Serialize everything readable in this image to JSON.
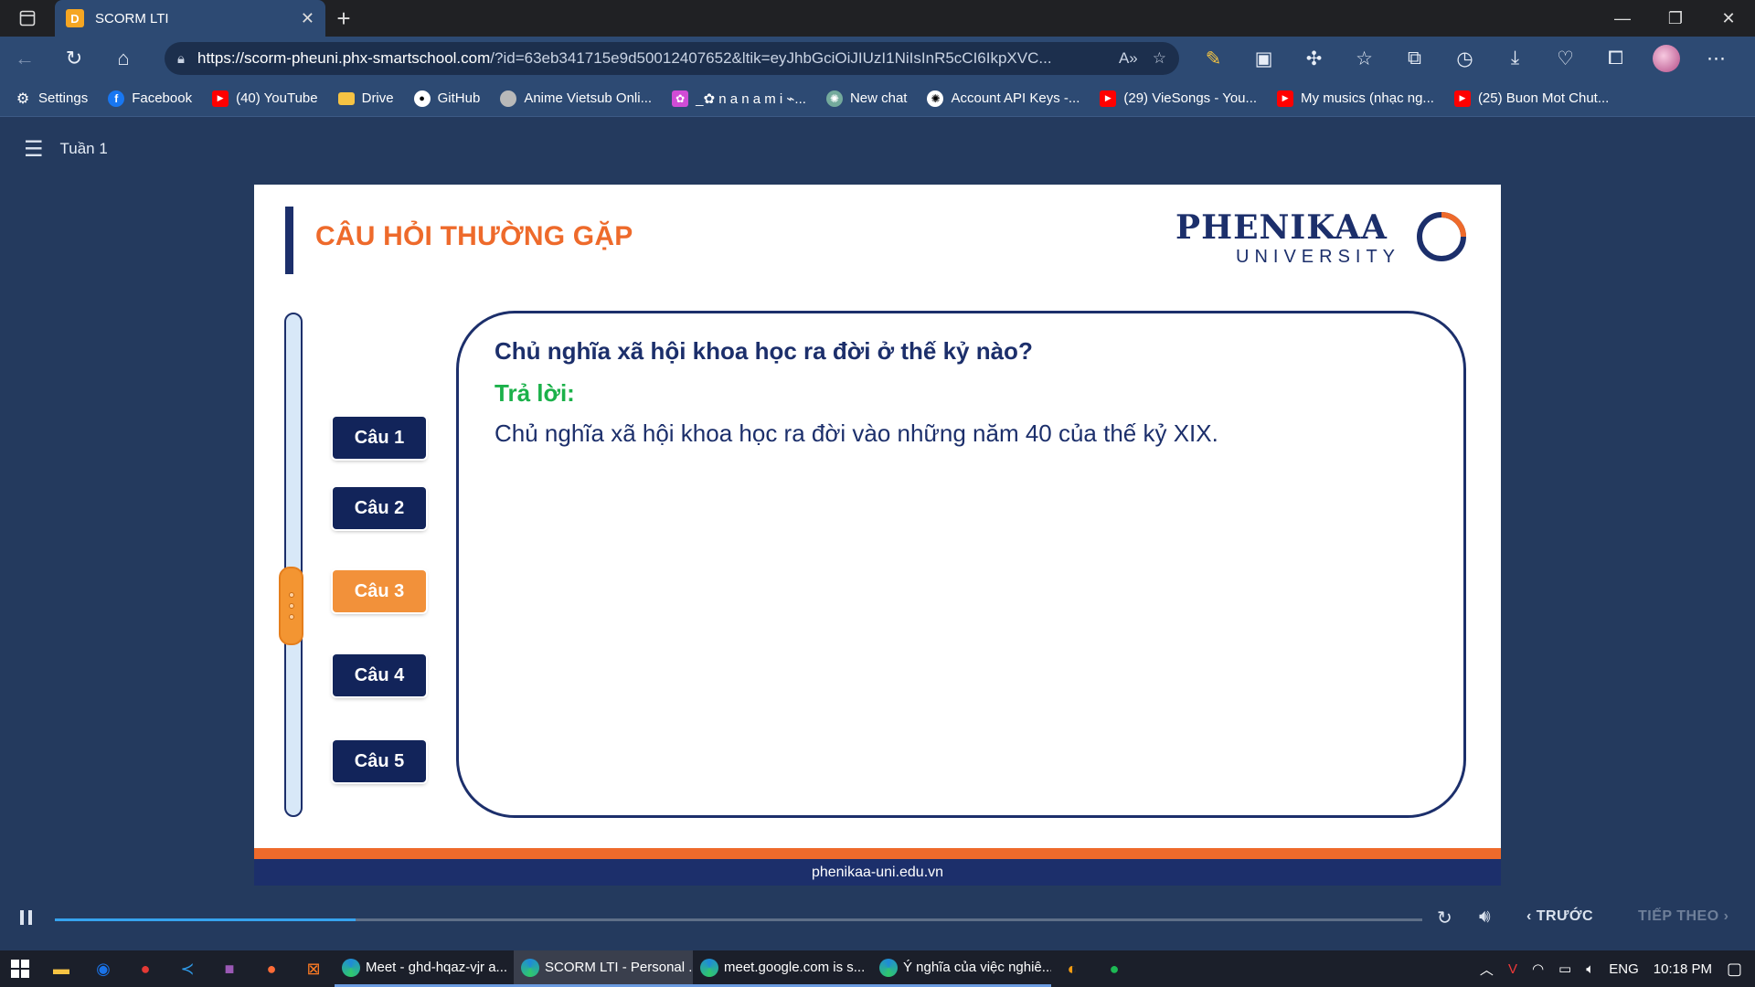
{
  "browser": {
    "tab": {
      "title": "SCORM LTI",
      "favicon_letter": "D"
    },
    "url_host": "https://scorm-pheuni.phx-smartschool.com",
    "url_rest": "/?id=63eb341715e9d50012407652&ltik=eyJhbGciOiJIUzI1NiIsInR5cCI6IkpXVC...",
    "bookmarks": [
      {
        "label": "Settings",
        "icon": "gear-icon",
        "color": "#9aa7ba"
      },
      {
        "label": "Facebook",
        "icon": "facebook-icon",
        "color": "#1877f2"
      },
      {
        "label": "(40) YouTube",
        "icon": "youtube-icon",
        "color": "#ff0000"
      },
      {
        "label": "Drive",
        "icon": "folder-icon",
        "color": "#f6c343"
      },
      {
        "label": "GitHub",
        "icon": "github-icon",
        "color": "#ffffff"
      },
      {
        "label": "Anime Vietsub Onli...",
        "icon": "anime-icon",
        "color": "#b9b9b9"
      },
      {
        "label": "_✿ n a n a m i ⌁...",
        "icon": "flower-icon",
        "color": "#d04cd6"
      },
      {
        "label": "New chat",
        "icon": "chatgpt-icon",
        "color": "#74aa9c"
      },
      {
        "label": "Account API Keys -...",
        "icon": "openai-icon",
        "color": "#ffffff"
      },
      {
        "label": "(29) VieSongs - You...",
        "icon": "youtube-icon",
        "color": "#ff0000"
      },
      {
        "label": "My musics (nhạc ng...",
        "icon": "youtube-icon",
        "color": "#ff0000"
      },
      {
        "label": "(25) Buon Mot Chut...",
        "icon": "youtube-icon",
        "color": "#ff0000"
      }
    ]
  },
  "player": {
    "week_title": "Tuần 1",
    "progress": 0.22,
    "prev_label": "TRƯỚC",
    "next_label": "TIẾP THEO"
  },
  "slide": {
    "title": "CÂU HỎI THƯỜNG GẶP",
    "logo_name": "PHENIKAA",
    "logo_sub": "UNIVERSITY",
    "questions": [
      {
        "label": "Câu 1",
        "active": false
      },
      {
        "label": "Câu 2",
        "active": false
      },
      {
        "label": "Câu 3",
        "active": true
      },
      {
        "label": "Câu 4",
        "active": false
      },
      {
        "label": "Câu 5",
        "active": false
      }
    ],
    "question": "Chủ nghĩa xã hội khoa học ra đời ở thế kỷ nào?",
    "answer_label": "Trả lời:",
    "answer": "Chủ nghĩa xã hội khoa học ra đời vào những năm 40 của thế kỷ XIX.",
    "footer": "phenikaa-uni.edu.vn",
    "colors": {
      "accent": "#ee6a2b",
      "navy": "#1c2f6b",
      "green": "#1bb14a",
      "active_button": "#f2913a"
    }
  },
  "taskbar": {
    "windows": [
      {
        "label": "Meet - ghd-hqaz-vjr a...",
        "active": false
      },
      {
        "label": "SCORM LTI - Personal ...",
        "active": true
      },
      {
        "label": "meet.google.com is s...",
        "active": false
      },
      {
        "label": "Ý nghĩa của việc nghiê...",
        "active": false
      }
    ],
    "language": "ENG",
    "time": "10:18 PM"
  }
}
